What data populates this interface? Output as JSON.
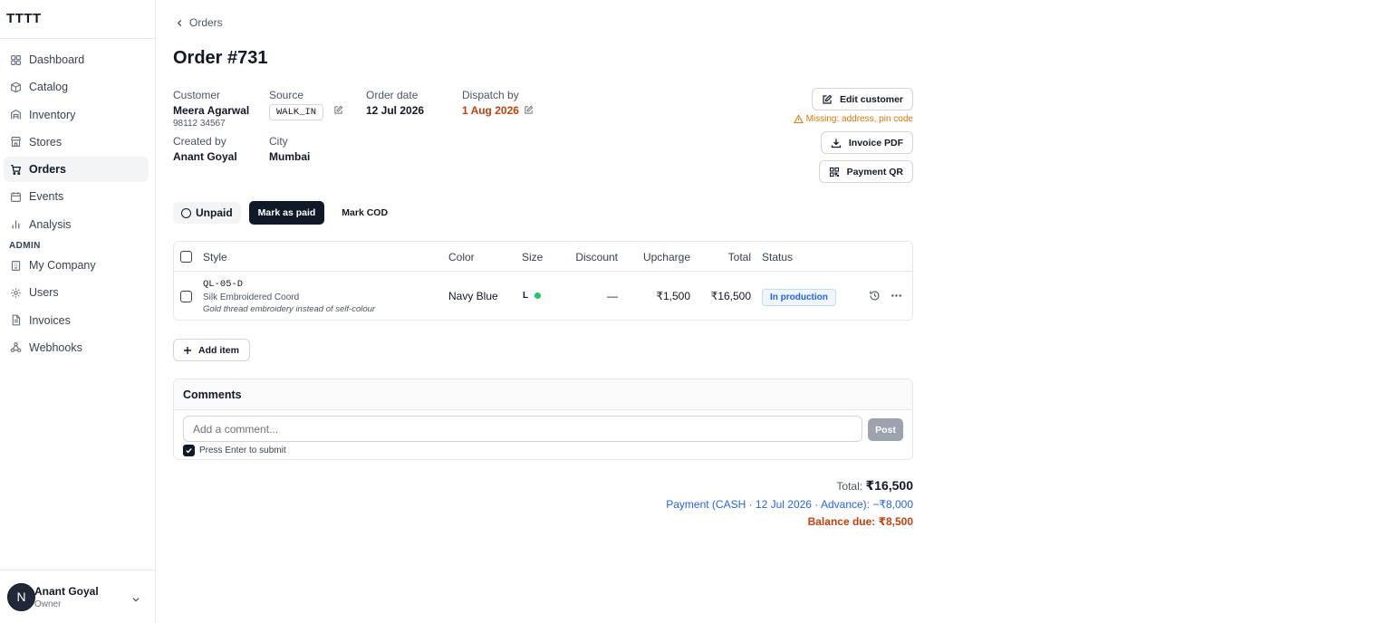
{
  "app": {
    "brand": "TTTT"
  },
  "sidebar": {
    "items": [
      {
        "label": "Dashboard",
        "icon": "dashboard-icon"
      },
      {
        "label": "Catalog",
        "icon": "box-icon"
      },
      {
        "label": "Inventory",
        "icon": "warehouse-icon"
      },
      {
        "label": "Stores",
        "icon": "store-icon"
      },
      {
        "label": "Orders",
        "icon": "cart-icon",
        "active": true
      },
      {
        "label": "Events",
        "icon": "calendar-icon"
      },
      {
        "label": "Analysis",
        "icon": "bar-chart-icon"
      }
    ],
    "admin_label": "ADMIN",
    "admin_items": [
      {
        "label": "My Company",
        "icon": "building-icon"
      },
      {
        "label": "Users",
        "icon": "gear-icon"
      },
      {
        "label": "Invoices",
        "icon": "file-icon"
      },
      {
        "label": "Webhooks",
        "icon": "webhook-icon"
      }
    ],
    "user": {
      "initial": "N",
      "name": "Anant Goyal",
      "role": "Owner"
    }
  },
  "breadcrumb": {
    "label": "Orders"
  },
  "order": {
    "title": "Order #731",
    "customer_label": "Customer",
    "customer_name": "Meera Agarwal",
    "customer_phone": "98112 34567",
    "source_label": "Source",
    "source_value": "WALK_IN",
    "order_date_label": "Order date",
    "order_date": "12 Jul 2026",
    "dispatch_label": "Dispatch by",
    "dispatch_date": "1 Aug 2026",
    "created_by_label": "Created by",
    "created_by": "Anant Goyal",
    "city_label": "City",
    "city": "Mumbai"
  },
  "actions": {
    "edit_customer": "Edit customer",
    "missing_warning": "Missing: address, pin code",
    "invoice_pdf": "Invoice PDF",
    "payment_qr": "Payment QR"
  },
  "payment": {
    "status": "Unpaid",
    "mark_paid": "Mark as paid",
    "mark_cod": "Mark COD"
  },
  "table": {
    "columns": [
      "Style",
      "Color",
      "Size",
      "Discount",
      "Upcharge",
      "Total",
      "Status"
    ],
    "rows": [
      {
        "code": "QL-05-D",
        "name": "Silk Embroidered Coord",
        "note": "Gold thread embroidery instead of self-colour",
        "color": "Navy Blue",
        "size": "L",
        "discount": "—",
        "upcharge": "₹1,500",
        "total": "₹16,500",
        "status": "In production"
      }
    ],
    "add_item": "Add item"
  },
  "comments": {
    "title": "Comments",
    "placeholder": "Add a comment...",
    "post": "Post",
    "enter_hint": "Press Enter to submit"
  },
  "summary": {
    "total_label": "Total:",
    "total_value": "₹16,500",
    "payment_line": "Payment (CASH · 12 Jul 2026 · Advance): −₹8,000",
    "balance_line": "Balance due: ₹8,500"
  },
  "colors": {
    "accent_dark": "#111827",
    "warning": "#d97706",
    "dispatch_orange": "#c2410c",
    "info_blue": "#2563eb",
    "size_dot_green": "#22c55e"
  }
}
